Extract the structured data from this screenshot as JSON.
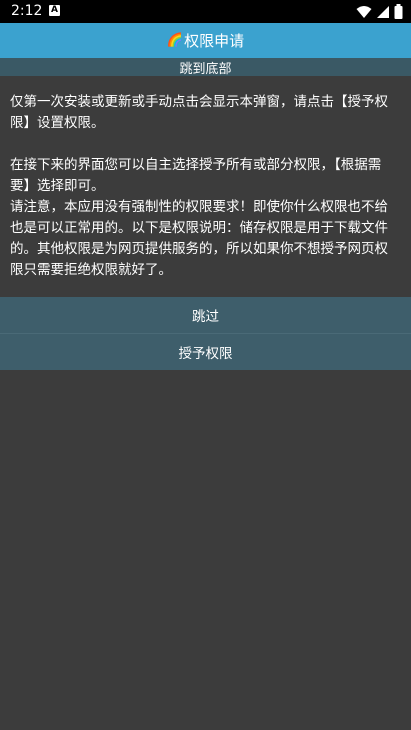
{
  "status_bar": {
    "time": "2:12",
    "notification_icon": "a-notification-icon",
    "icons": [
      "wifi-icon",
      "signal-icon",
      "battery-icon"
    ]
  },
  "app_bar": {
    "emoji": "🌈",
    "title": "权限申请",
    "background": "#3ba2cf"
  },
  "jump_bottom": {
    "label": "跳到底部",
    "background": "#3a5965"
  },
  "content": {
    "para1": "仅第一次安装或更新或手动点击会显示本弹窗，请点击【授予权限】设置权限。",
    "para2": "在接下来的界面您可以自主选择授予所有或部分权限，【根据需要】选择即可。",
    "para3": "请注意，本应用没有强制性的权限要求！即使你什么权限也不给也是可以正常用的。以下是权限说明：储存权限是用于下载文件的。其他权限是为网页提供服务的，所以如果你不想授予网页权限只需要拒绝权限就好了。"
  },
  "actions": {
    "skip_label": "跳过",
    "grant_label": "授予权限",
    "background": "#3e5e6b"
  }
}
